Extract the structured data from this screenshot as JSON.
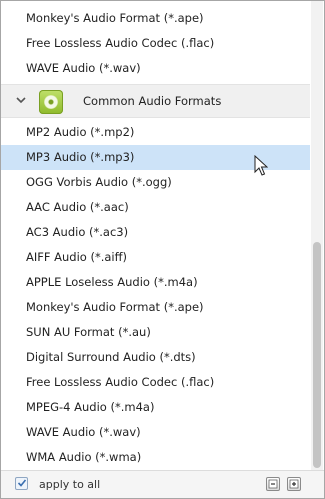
{
  "list": {
    "items_before_group": [
      {
        "label": "Monkey's Audio Format (*.ape)"
      },
      {
        "label": "Free Lossless Audio Codec (.flac)"
      },
      {
        "label": "WAVE Audio (*.wav)"
      }
    ],
    "group": {
      "label": "Common Audio Formats",
      "icon": "audio-format-icon",
      "expanded": true,
      "items": [
        {
          "label": "MP2 Audio (*.mp2)"
        },
        {
          "label": "MP3 Audio (*.mp3)",
          "selected": true
        },
        {
          "label": "OGG Vorbis Audio (*.ogg)"
        },
        {
          "label": "AAC Audio (*.aac)"
        },
        {
          "label": "AC3 Audio (*.ac3)"
        },
        {
          "label": "AIFF Audio (*.aiff)"
        },
        {
          "label": "APPLE Loseless Audio (*.m4a)"
        },
        {
          "label": "Monkey's Audio Format (*.ape)"
        },
        {
          "label": "SUN AU Format (*.au)"
        },
        {
          "label": "Digital Surround Audio (*.dts)"
        },
        {
          "label": "Free Lossless Audio Codec (.flac)"
        },
        {
          "label": "MPEG-4 Audio (*.m4a)"
        },
        {
          "label": "WAVE Audio (*.wav)"
        },
        {
          "label": "WMA Audio (*.wma)"
        }
      ]
    }
  },
  "footer": {
    "apply_to_all_label": "apply to all",
    "apply_to_all_checked": true,
    "buttons": [
      "collapse-all-icon",
      "expand-all-icon"
    ]
  },
  "colors": {
    "selected_row": "#cde3f8",
    "accent_icon": "#8fba2b"
  }
}
